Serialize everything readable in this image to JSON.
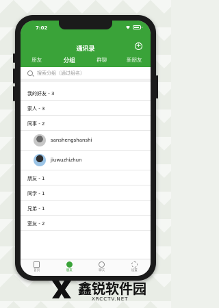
{
  "status_bar": {
    "time": "7:02"
  },
  "header": {
    "title": "通讯录",
    "add_icon": "plus-icon"
  },
  "tabs": [
    {
      "label": "朋友"
    },
    {
      "label": "分组"
    },
    {
      "label": "群聊"
    },
    {
      "label": "新朋友"
    }
  ],
  "search": {
    "placeholder": "搜索分组（通过组名）"
  },
  "groups": [
    {
      "label": "我的好友 - 3"
    },
    {
      "label": "家人 - 3"
    },
    {
      "label": "同事 - 2"
    },
    {
      "label": "朋友 - 1"
    },
    {
      "label": "同学 - 1"
    },
    {
      "label": "兄弟 - 1"
    },
    {
      "label": "室友 - 2"
    }
  ],
  "members": [
    {
      "name": "sanshengshanshi"
    },
    {
      "name": "jiuwuzhizhun"
    }
  ],
  "tabbar": [
    {
      "label": "首页",
      "icon": "house-icon"
    },
    {
      "label": "朋友",
      "icon": "frog-icon"
    },
    {
      "label": "聊天",
      "icon": "chat-icon"
    },
    {
      "label": "设置",
      "icon": "gear-icon"
    }
  ],
  "watermark": {
    "title": "鑫锐软件园",
    "url": "XRCCTV.NET"
  },
  "colors": {
    "accent": "#3aa339",
    "background": "#e9ede6"
  }
}
